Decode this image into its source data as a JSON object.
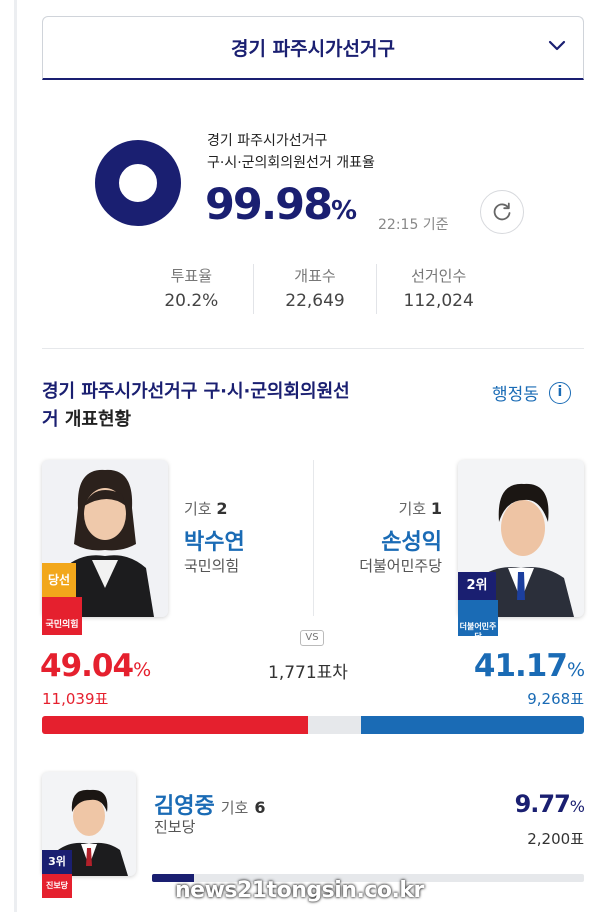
{
  "dropdown": {
    "label": "경기 파주시가선거구"
  },
  "summary": {
    "region": "경기 파주시가선거구",
    "election": "구·시·군의회의원선거 개표율",
    "rate": "99.98",
    "rate_unit": "%",
    "rate_fraction": 0.9998,
    "time": "22:15 기준",
    "stats": [
      {
        "label": "투표율",
        "value": "20.2%"
      },
      {
        "label": "개표수",
        "value": "22,649"
      },
      {
        "label": "선거인수",
        "value": "112,024"
      }
    ]
  },
  "section": {
    "title_main": "경기 파주시가선거구 구·시·군의회의원선",
    "title_line2_a": "거",
    "title_line2_b": " 개표현황",
    "region_link": "행정동",
    "info_icon": "i"
  },
  "candidates": {
    "left": {
      "num_label": "기호",
      "num": "2",
      "name": "박수연",
      "party": "국민의힘",
      "badge": "당선",
      "party_badge": "국민의힘",
      "pct": "49.04",
      "pct_unit": "%",
      "votes": "11,039표",
      "color": "#e5202e",
      "share": 0.4904
    },
    "right": {
      "num_label": "기호",
      "num": "1",
      "name": "손성익",
      "party": "더불어민주당",
      "badge": "2위",
      "party_badge": "더불어민주당",
      "pct": "41.17",
      "pct_unit": "%",
      "votes": "9,268표",
      "color": "#1a6bb5",
      "share": 0.4117
    },
    "vs": "VS",
    "diff": "1,771표차"
  },
  "third": {
    "name": "김영중",
    "num_label": "기호",
    "num": "6",
    "party": "진보당",
    "badge": "3위",
    "party_badge": "진보당",
    "pct": "9.77",
    "pct_unit": "%",
    "votes": "2,200표",
    "share": 0.0977
  },
  "watermark": "news21tongsin.co.kr",
  "colors": {
    "navy": "#1a1f71",
    "red": "#e5202e",
    "blue": "#1a6bb5"
  }
}
